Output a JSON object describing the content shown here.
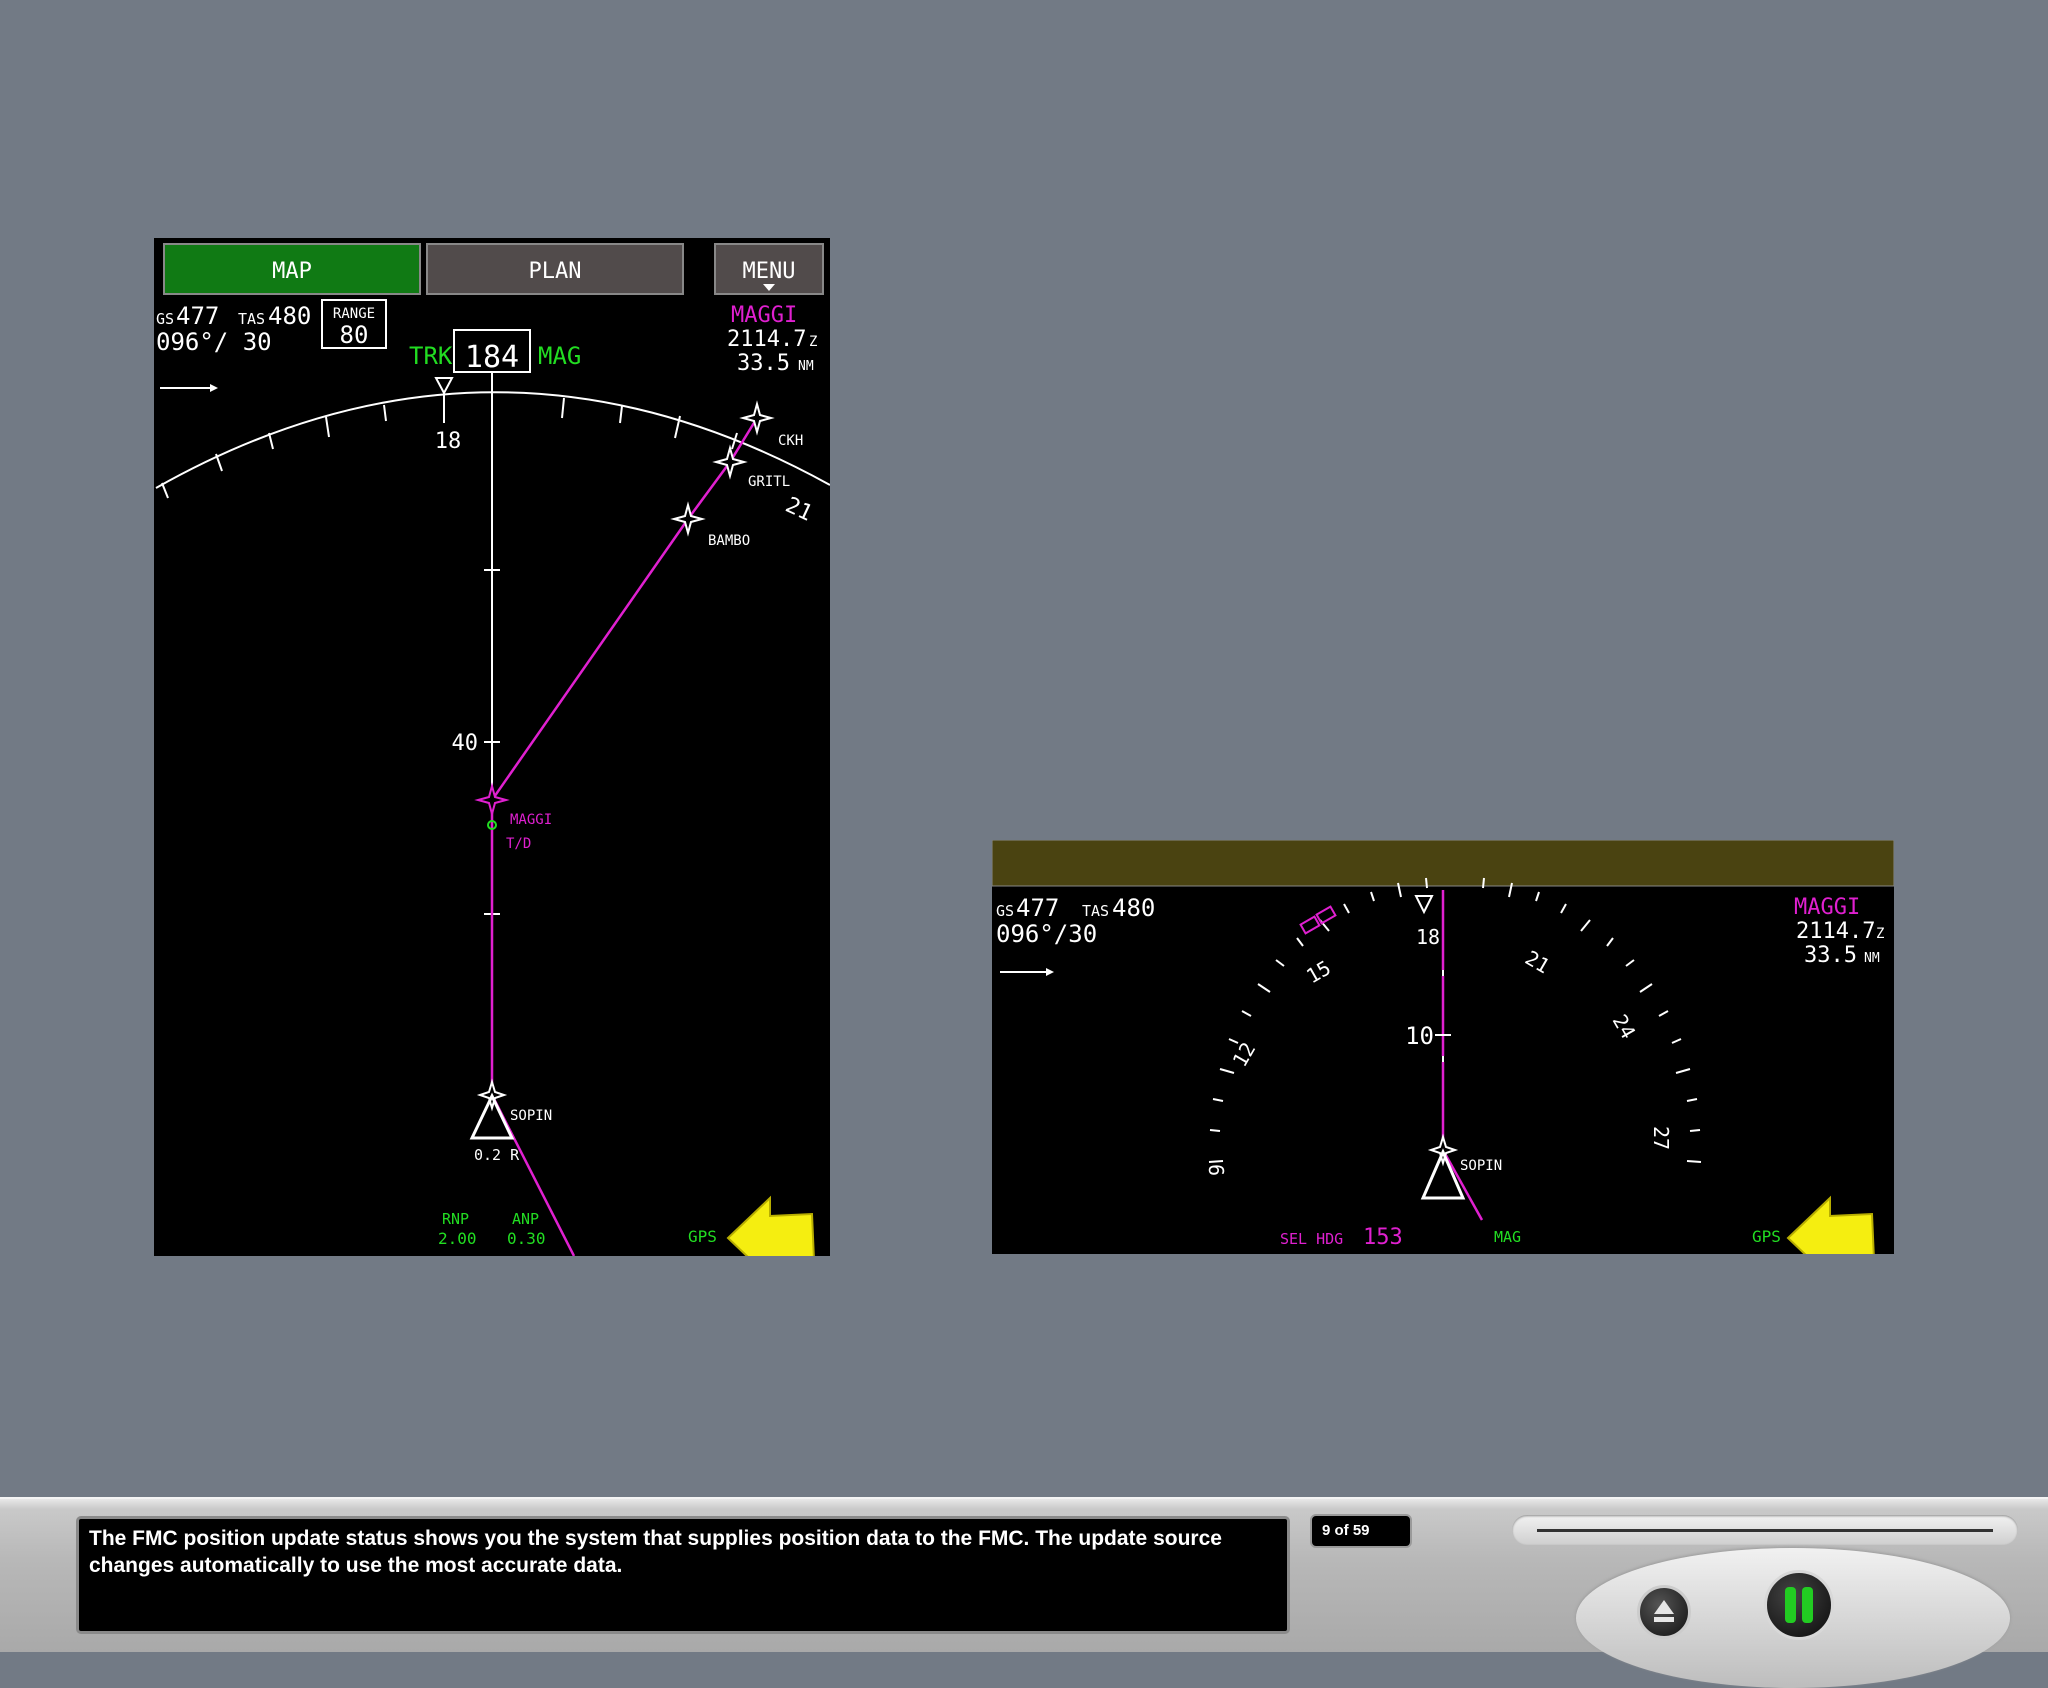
{
  "nd_map": {
    "tabs": [
      {
        "label": "MAP",
        "active": true
      },
      {
        "label": "PLAN",
        "active": false
      },
      {
        "label": "MENU",
        "active": false
      }
    ],
    "gs_label": "GS",
    "gs_value": "477",
    "tas_label": "TAS",
    "tas_value": "480",
    "wind": "096°/ 30",
    "range_label": "RANGE",
    "range_value": "80",
    "trk_label": "TRK",
    "heading": "184",
    "mag_label": "MAG",
    "next_wpt": "MAGGI",
    "eta": "2114.7",
    "eta_unit": "Z",
    "dist": "33.5",
    "dist_unit": "NM",
    "compass_labels": [
      "18",
      "21"
    ],
    "range_mark": "40",
    "waypoints": [
      "CKH",
      "GRITL",
      "BAMBO",
      "SOPIN"
    ],
    "route_labels": [
      "MAGGI",
      "T/D"
    ],
    "xtk": "0.2 R",
    "rnp_label": "RNP",
    "rnp_value": "2.00",
    "anp_label": "ANP",
    "anp_value": "0.30",
    "position_source": "GPS"
  },
  "nd_hsi": {
    "gs_label": "GS",
    "gs_value": "477",
    "tas_label": "TAS",
    "tas_value": "480",
    "wind": "096°/30",
    "next_wpt": "MAGGI",
    "eta": "2114.7",
    "eta_unit": "Z",
    "dist": "33.5",
    "dist_unit": "NM",
    "compass_labels": [
      "9",
      "12",
      "15",
      "18",
      "21",
      "24",
      "27"
    ],
    "range_mark": "10",
    "waypoint": "SOPIN",
    "sel_hdg_label": "SEL HDG",
    "sel_hdg_value": "153",
    "mag_label": "MAG",
    "position_source": "GPS"
  },
  "caption": "The FMC position update status shows you the system that supplies position data to the FMC.  The update source changes automatically to use the most accurate data.",
  "page_counter": "9 of 59",
  "colors": {
    "magenta": "#e020d0",
    "green": "#22dd22",
    "tab_active": "#107a14",
    "hsi_header": "#4a4311",
    "arrow": "#f5ee10"
  }
}
